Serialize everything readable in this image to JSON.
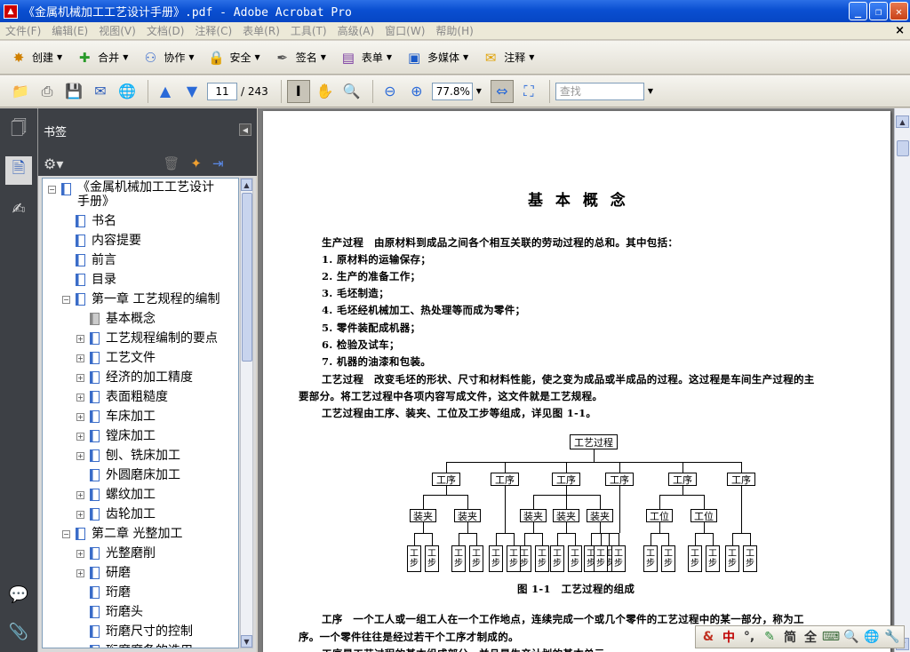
{
  "window": {
    "title": "《金属机械加工工艺设计手册》.pdf - Adobe Acrobat Pro"
  },
  "menu": [
    "文件(F)",
    "编辑(E)",
    "视图(V)",
    "文档(D)",
    "注释(C)",
    "表单(R)",
    "工具(T)",
    "高级(A)",
    "窗口(W)",
    "帮助(H)"
  ],
  "toolbar1": [
    {
      "label": "创建",
      "icon": "create-icon"
    },
    {
      "label": "合并",
      "icon": "combine-icon"
    },
    {
      "label": "协作",
      "icon": "collaborate-icon"
    },
    {
      "label": "安全",
      "icon": "lock-icon"
    },
    {
      "label": "签名",
      "icon": "pen-icon"
    },
    {
      "label": "表单",
      "icon": "form-icon"
    },
    {
      "label": "多媒体",
      "icon": "multimedia-icon"
    },
    {
      "label": "注释",
      "icon": "comment-icon"
    }
  ],
  "nav": {
    "page": "11",
    "total": "/ 243",
    "zoom": "77.8%",
    "search_placeholder": "查找"
  },
  "bookmarks": {
    "title": "书签",
    "items": [
      {
        "label": "《金属机械加工工艺设计",
        "label2": "手册》",
        "level": 0,
        "expander": "minus"
      },
      {
        "label": "书名",
        "level": 1,
        "expander": "none"
      },
      {
        "label": "内容提要",
        "level": 1,
        "expander": "none"
      },
      {
        "label": "前言",
        "level": 1,
        "expander": "none"
      },
      {
        "label": "目录",
        "level": 1,
        "expander": "none"
      },
      {
        "label": "第一章 工艺规程的编制",
        "level": 1,
        "expander": "minus"
      },
      {
        "label": "基本概念",
        "level": 2,
        "expander": "none",
        "selected": true
      },
      {
        "label": "工艺规程编制的要点",
        "level": 2,
        "expander": "plus"
      },
      {
        "label": "工艺文件",
        "level": 2,
        "expander": "plus"
      },
      {
        "label": "经济的加工精度",
        "level": 2,
        "expander": "plus"
      },
      {
        "label": "表面粗糙度",
        "level": 2,
        "expander": "plus"
      },
      {
        "label": "车床加工",
        "level": 2,
        "expander": "plus"
      },
      {
        "label": "镗床加工",
        "level": 2,
        "expander": "plus"
      },
      {
        "label": "刨、铣床加工",
        "level": 2,
        "expander": "plus"
      },
      {
        "label": "外圆磨床加工",
        "level": 2,
        "expander": "none"
      },
      {
        "label": "螺纹加工",
        "level": 2,
        "expander": "plus"
      },
      {
        "label": "齿轮加工",
        "level": 2,
        "expander": "plus"
      },
      {
        "label": "第二章 光整加工",
        "level": 1,
        "expander": "minus"
      },
      {
        "label": "光整磨削",
        "level": 2,
        "expander": "plus"
      },
      {
        "label": "研磨",
        "level": 2,
        "expander": "plus"
      },
      {
        "label": "珩磨",
        "level": 2,
        "expander": "none"
      },
      {
        "label": "珩磨头",
        "level": 2,
        "expander": "none"
      },
      {
        "label": "珩磨尺寸的控制",
        "level": 2,
        "expander": "none"
      },
      {
        "label": "珩磨磨条的选用",
        "level": 2,
        "expander": "none"
      }
    ]
  },
  "doc": {
    "heading": "基 本 概 念",
    "lines": [
      "生产过程　由原材料到成品之间各个相互关联的劳动过程的总和。其中包括：",
      "1. 原材料的运输保存；",
      "2. 生产的准备工作；",
      "3. 毛坯制造；",
      "4. 毛坯经机械加工、热处理等而成为零件；",
      "5. 零件装配成机器；",
      "6. 检验及试车；",
      "7. 机器的油漆和包装。",
      "工艺过程　改变毛坯的形状、尺寸和材料性能，使之变为成品或半成品的过程。这过程是车间生产过程的主",
      "要部分。将工艺过程中各项内容写成文件，这文件就是工艺规程。",
      "工艺过程由工序、装夹、工位及工步等组成，详见图 1-1。"
    ],
    "diagram": {
      "root": "工艺过程",
      "process": "工序",
      "clamp": "装夹",
      "station": "工位",
      "step_top": "工",
      "step_bottom": "步",
      "caption": "图 1-1　工艺过程的组成"
    },
    "bottom_lines": [
      "工序　一个工人或一组工人在一个工作地点，连续完成一个或几个零件的工艺过程中的某一部分，称为工",
      "序。一个零件往往是经过若干个工序才制成的。",
      "工序是工艺过程的基本组成部分，并且是生产计划的基本单元。"
    ]
  },
  "ime": [
    "&",
    "中",
    "°,",
    "✎",
    "简",
    "全",
    "⌨",
    "🔍",
    "🌐",
    "🔧"
  ]
}
